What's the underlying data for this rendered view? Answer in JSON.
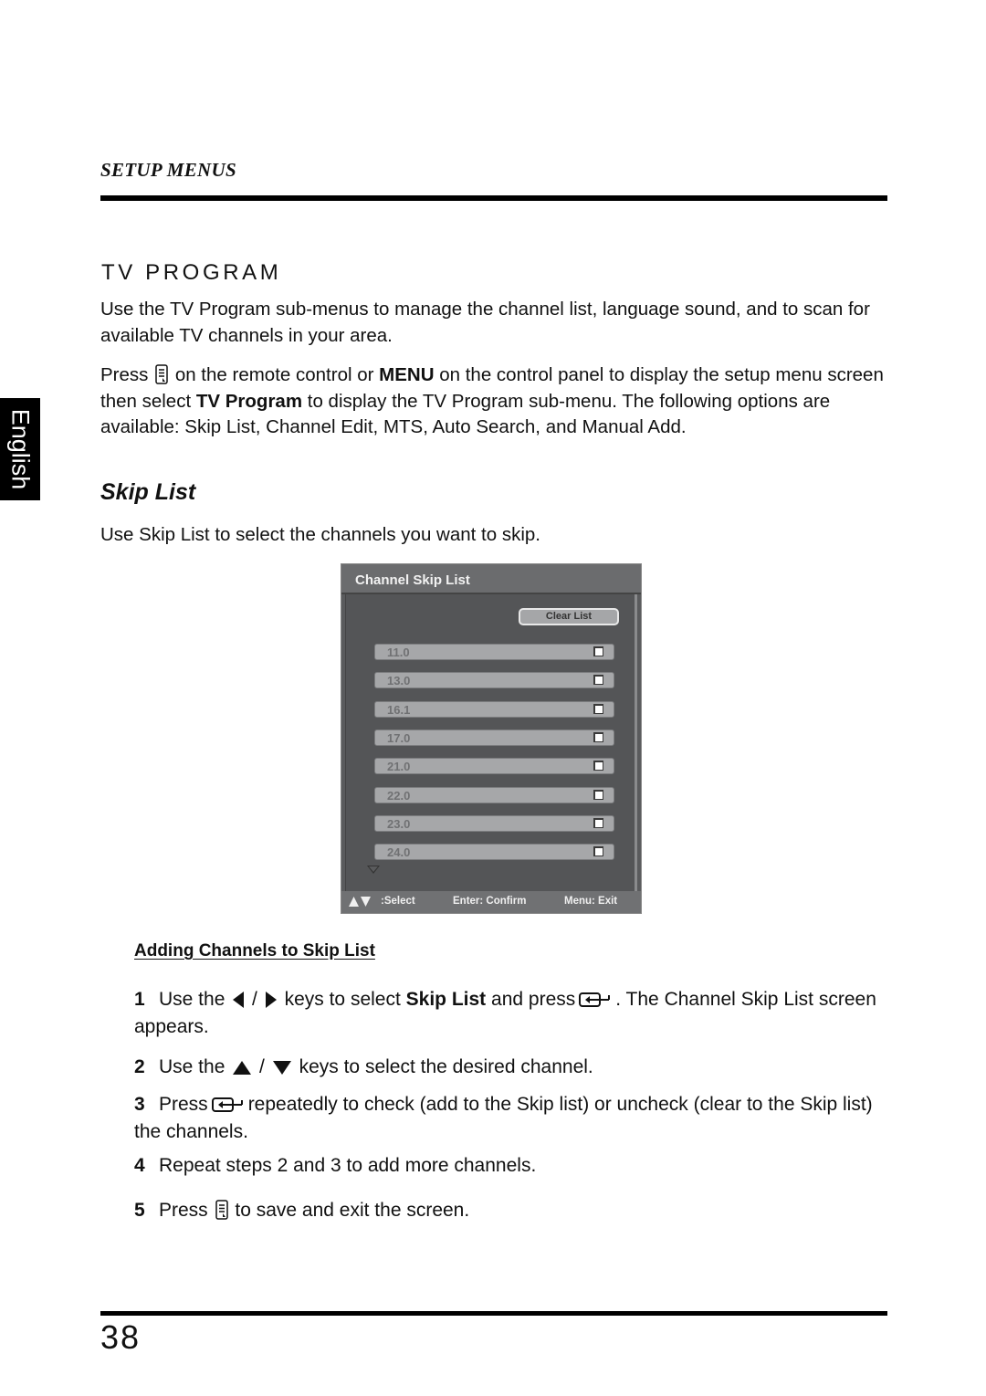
{
  "header": {
    "running_head": "SETUP MENUS"
  },
  "side_tab": {
    "label": "English"
  },
  "section": {
    "title": "TV PROGRAM",
    "intro": "Use the TV Program sub-menus to manage the channel list, language sound, and to scan for available TV channels in your area.",
    "para2": {
      "part1": "Press",
      "part2": "on the remote control or",
      "menu_bold": "MENU",
      "part3": "on the control panel to display the setup menu screen then select",
      "tvprogram_bold": "TV Program",
      "part4": "to display the TV Program sub-menu. The following options are available: Skip List, Channel Edit, MTS, Auto Search, and Manual Add."
    }
  },
  "subsection": {
    "title": "Skip List",
    "intro": "Use Skip List to select the channels you want to skip."
  },
  "osd": {
    "title": "Channel Skip List",
    "clear_button": "Clear List",
    "channels": [
      {
        "number": "11.0",
        "checked": false
      },
      {
        "number": "13.0",
        "checked": false
      },
      {
        "number": "16.1",
        "checked": false
      },
      {
        "number": "17.0",
        "checked": false
      },
      {
        "number": "21.0",
        "checked": false
      },
      {
        "number": "22.0",
        "checked": false
      },
      {
        "number": "23.0",
        "checked": false
      },
      {
        "number": "24.0",
        "checked": false
      }
    ],
    "footer": {
      "select": ":Select",
      "confirm": "Enter: Confirm",
      "exit": "Menu: Exit"
    },
    "colors": {
      "panel": "#5a5b5d",
      "row": "#a6a7a9",
      "text": "#707173"
    }
  },
  "instructions": {
    "heading": "Adding Channels to Skip List",
    "steps": [
      {
        "n": "1",
        "a": "Use the",
        "b": "keys to select",
        "bold": "Skip List",
        "c": "and press",
        "d": ". The Channel Skip List screen appears."
      },
      {
        "n": "2",
        "a": "Use the",
        "b": "keys to select the desired channel."
      },
      {
        "n": "3",
        "a": "Press",
        "b": "repeatedly to check (add to the Skip list) or uncheck (clear to the Skip list) the channels."
      },
      {
        "n": "4",
        "a": "Repeat steps 2 and 3 to add more channels."
      },
      {
        "n": "5",
        "a": "Press",
        "b": "to save and exit the screen."
      }
    ]
  },
  "footer": {
    "page_number": "38"
  }
}
